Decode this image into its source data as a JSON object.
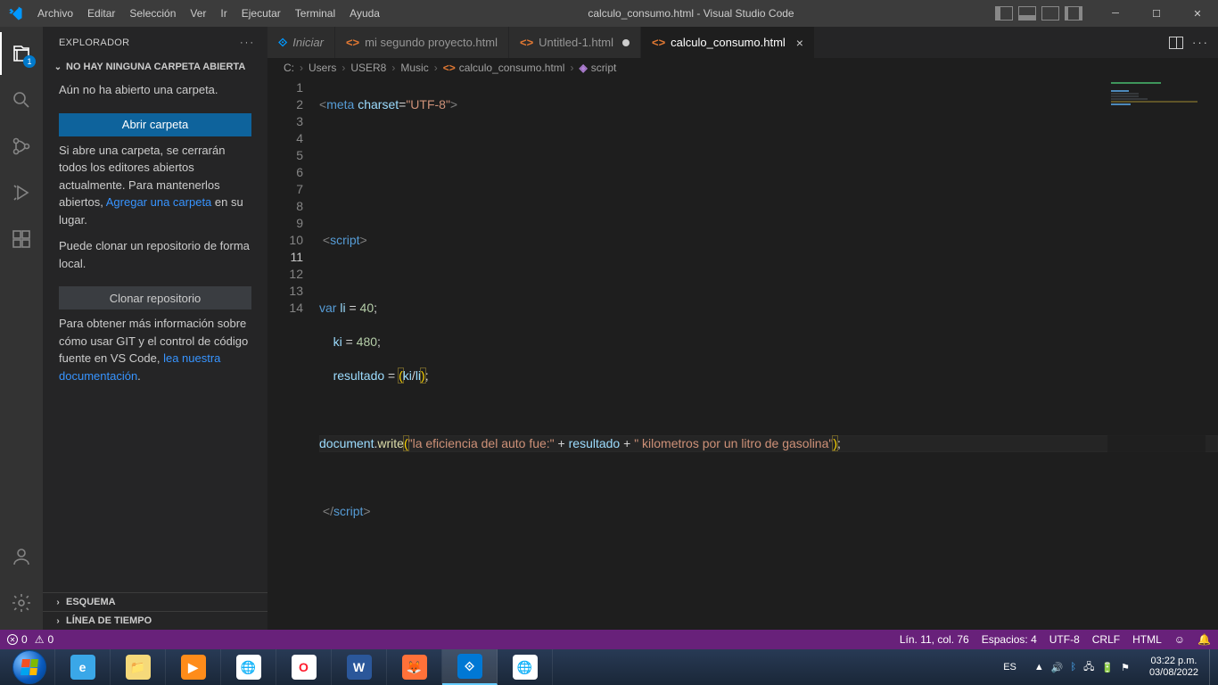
{
  "title": "calculo_consumo.html - Visual Studio Code",
  "menu": [
    "Archivo",
    "Editar",
    "Selección",
    "Ver",
    "Ir",
    "Ejecutar",
    "Terminal",
    "Ayuda"
  ],
  "activity_badge": "1",
  "sidebar": {
    "header": "EXPLORADOR",
    "section_open": "NO HAY NINGUNA CARPETA ABIERTA",
    "no_folder": "Aún no ha abierto una carpeta.",
    "open_folder_btn": "Abrir carpeta",
    "note_1a": "Si abre una carpeta, se cerrarán todos los editores abiertos actualmente. Para mantenerlos abiertos, ",
    "note_1_link": "Agregar una carpeta",
    "note_1b": " en su lugar.",
    "note_2": "Puede clonar un repositorio de forma local.",
    "clone_btn": "Clonar repositorio",
    "note_3a": "Para obtener más información sobre cómo usar GIT y el control de código fuente en VS Code, ",
    "note_3_link": "lea nuestra documentación",
    "note_3b": ".",
    "section_outline": "ESQUEMA",
    "section_timeline": "LÍNEA DE TIEMPO"
  },
  "tabs": [
    {
      "icon": "vs",
      "label": "Iniciar",
      "italic": true,
      "dirty": false,
      "active": false,
      "close": false
    },
    {
      "icon": "html",
      "label": "mi segundo proyecto.html",
      "italic": false,
      "dirty": false,
      "active": false,
      "close": false
    },
    {
      "icon": "html",
      "label": "Untitled-1.html",
      "italic": false,
      "dirty": true,
      "active": false,
      "close": false
    },
    {
      "icon": "html",
      "label": "calculo_consumo.html",
      "italic": false,
      "dirty": false,
      "active": true,
      "close": true
    }
  ],
  "breadcrumb": {
    "parts": [
      "C:",
      "Users",
      "USER8",
      "Music"
    ],
    "file": "calculo_consumo.html",
    "symbol": "script"
  },
  "code": {
    "lines": [
      1,
      2,
      3,
      4,
      5,
      6,
      7,
      8,
      9,
      10,
      11,
      12,
      13,
      14
    ],
    "meta_tag": "meta",
    "meta_attr": "charset",
    "meta_val": "\"UTF-8\"",
    "script_tag": "script",
    "kw_var": "var",
    "v_li": "li",
    "n_40": "40",
    "v_ki": "ki",
    "n_480": "480",
    "v_res": "resultado",
    "obj_doc": "document",
    "fn_write": "write",
    "str1": "\"la eficiencia del auto fue:\"",
    "str2": "\" kilometros por un litro de gasolina\"",
    "current_line": 11
  },
  "status": {
    "errors": "0",
    "warnings": "0",
    "ln_col": "Lín. 11, col. 76",
    "spaces": "Espacios: 4",
    "encoding": "UTF-8",
    "eol": "CRLF",
    "lang": "HTML"
  },
  "taskbar": {
    "lang": "ES",
    "time": "03:22 p.m.",
    "date": "03/08/2022"
  }
}
